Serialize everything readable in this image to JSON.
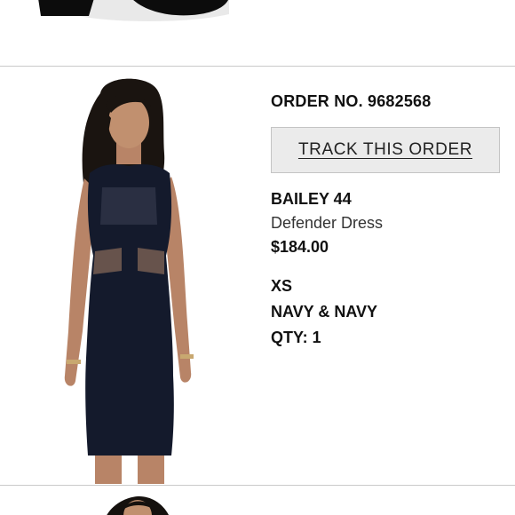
{
  "order": {
    "order_number_label": "ORDER NO. 9682568",
    "track_button_label": "TRACK THIS ORDER",
    "brand": "BAILEY 44",
    "product_name": "Defender Dress",
    "price": "$184.00",
    "size": "XS",
    "color": "NAVY & NAVY",
    "quantity": "QTY: 1"
  },
  "colors": {
    "button_bg": "#ebebeb",
    "divider": "#c9c9c9",
    "dress_navy": "#141a2c"
  }
}
